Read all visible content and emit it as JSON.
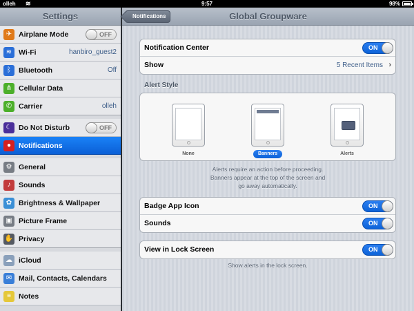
{
  "statusbar": {
    "carrier": "olleh",
    "time": "9:57",
    "battery": "98%"
  },
  "master": {
    "title": "Settings",
    "items": [
      {
        "label": "Airplane Mode",
        "toggle": "OFF",
        "icon": "airplane-icon",
        "color": "#e07a1a"
      },
      {
        "label": "Wi-Fi",
        "value": "hanbiro_guest2",
        "icon": "wifi-icon",
        "color": "#2b6fd8"
      },
      {
        "label": "Bluetooth",
        "value": "Off",
        "icon": "bluetooth-icon",
        "color": "#2b6fd8"
      },
      {
        "label": "Cellular Data",
        "icon": "antenna-icon",
        "color": "#4caf2a"
      },
      {
        "label": "Carrier",
        "value": "olleh",
        "icon": "phone-icon",
        "color": "#4caf2a"
      },
      {
        "label": "Do Not Disturb",
        "toggle": "OFF",
        "icon": "moon-icon",
        "color": "#4a2e9a"
      },
      {
        "label": "Notifications",
        "icon": "notifications-icon",
        "color": "#d62020"
      },
      {
        "label": "General",
        "icon": "gear-icon",
        "color": "#777c84"
      },
      {
        "label": "Sounds",
        "icon": "speaker-icon",
        "color": "#c23b3b"
      },
      {
        "label": "Brightness & Wallpaper",
        "icon": "flower-icon",
        "color": "#3a8fd6"
      },
      {
        "label": "Picture Frame",
        "icon": "picture-frame-icon",
        "color": "#777c84"
      },
      {
        "label": "Privacy",
        "icon": "hand-icon",
        "color": "#555a62"
      },
      {
        "label": "iCloud",
        "icon": "cloud-icon",
        "color": "#8aa0bb"
      },
      {
        "label": "Mail, Contacts, Calendars",
        "icon": "mail-icon",
        "color": "#3a7fd8"
      },
      {
        "label": "Notes",
        "icon": "notes-icon",
        "color": "#e5c83a"
      }
    ]
  },
  "detail": {
    "back": "Notifications",
    "title": "Global Groupware",
    "notification_center": {
      "label": "Notification Center",
      "toggle": "ON"
    },
    "show": {
      "label": "Show",
      "value": "5 Recent Items"
    },
    "alert_style_label": "Alert Style",
    "alert_options": [
      "None",
      "Banners",
      "Alerts"
    ],
    "alert_note": "Alerts require an action before proceeding.\nBanners appear at the top of the screen and go away automatically.",
    "alert_note_line1": "Alerts require an action before proceeding.",
    "alert_note_line2": "Banners appear at the top of the screen and",
    "alert_note_line3": "go away automatically.",
    "badge": {
      "label": "Badge App Icon",
      "toggle": "ON"
    },
    "sounds": {
      "label": "Sounds",
      "toggle": "ON"
    },
    "lock_screen": {
      "label": "View in Lock Screen",
      "toggle": "ON"
    },
    "lock_note": "Show alerts in the lock screen."
  }
}
